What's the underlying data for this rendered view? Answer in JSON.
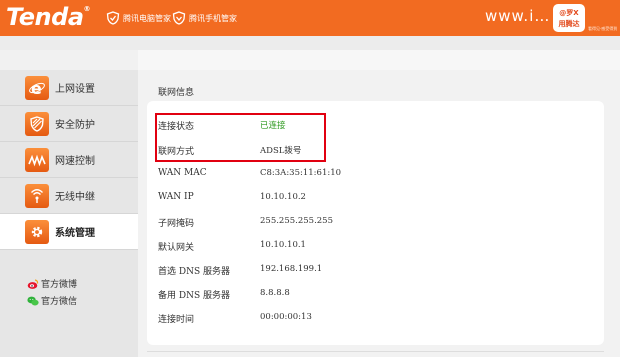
{
  "header": {
    "logo": "Tenda",
    "logo_mark": "®",
    "link_pc": "腾讯电脑管家",
    "link_mobile": "腾讯手机管家",
    "watermark": "www.i…",
    "badge_line1": "@罗X",
    "badge_line2": "用腾达",
    "badge_caption": "看得见·感受得到"
  },
  "colors": {
    "brand": "#f26b21",
    "connected": "#2e9a1f",
    "highlight_border": "#e10010"
  },
  "sidebar": {
    "items": [
      {
        "label": "上网设置",
        "icon": "internet-e-icon",
        "active": false
      },
      {
        "label": "安全防护",
        "icon": "shield-stripes-icon",
        "active": false
      },
      {
        "label": "网速控制",
        "icon": "speed-wave-icon",
        "active": false
      },
      {
        "label": "无线中继",
        "icon": "wireless-relay-icon",
        "active": false
      },
      {
        "label": "系统管理",
        "icon": "gear-icon",
        "active": true
      }
    ],
    "social": [
      {
        "label": "官方微博",
        "icon": "weibo-icon"
      },
      {
        "label": "官方微信",
        "icon": "wechat-icon"
      }
    ]
  },
  "panel": {
    "title": "联网信息",
    "rows": [
      {
        "label": "连接状态",
        "value": "已连接",
        "status": "ok"
      },
      {
        "label": "联网方式",
        "value": "ADSL拨号"
      },
      {
        "label": "WAN MAC",
        "value": "C8:3A:35:11:61:10"
      },
      {
        "label": "WAN IP",
        "value": "10.10.10.2"
      },
      {
        "label": "子网掩码",
        "value": "255.255.255.255"
      },
      {
        "label": "默认网关",
        "value": "10.10.10.1"
      },
      {
        "label": "首选 DNS 服务器",
        "value": "192.168.199.1"
      },
      {
        "label": "备用 DNS 服务器",
        "value": "8.8.8.8"
      },
      {
        "label": "连接时间",
        "value": "00:00:00:13"
      }
    ]
  }
}
